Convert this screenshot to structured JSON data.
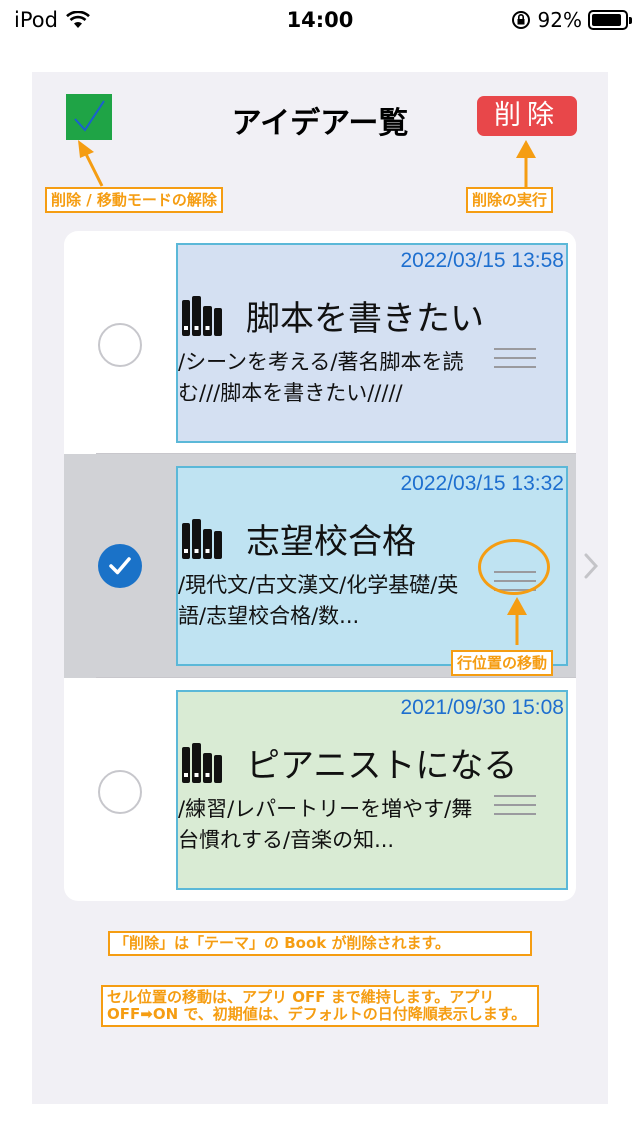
{
  "status_bar": {
    "carrier": "iPod",
    "time": "14:00",
    "battery_percent": "92%",
    "icons": [
      "wifi-icon",
      "rotation-lock-icon",
      "battery-icon"
    ]
  },
  "header": {
    "title": "アイデアー覧",
    "delete_label": "削除",
    "done_icon": "checkmark-icon"
  },
  "annotations": {
    "done_note": "削除 / 移動モードの解除",
    "delete_note": "削除の実行",
    "reorder_note": "行位置の移動",
    "book_note": "「削除」は「テーマ」の Book が削除されます。",
    "cell_note": "セル位置の移動は、アプリ OFF まで維持します。アプリOFF➡ON で、初期値は、デフォルトの日付降順表示します。"
  },
  "items": [
    {
      "date": "2022/03/15 13:58",
      "title": "脚本を書きたい",
      "description": "/シーンを考える/著名脚本を読む///脚本を書きたい/////",
      "selected": false,
      "color": "#d4e0f2"
    },
    {
      "date": "2022/03/15 13:32",
      "title": "志望校合格",
      "description": "/現代文/古文漢文/化学基礎/英語/志望校合格/数...",
      "selected": true,
      "color": "#bfe3f2"
    },
    {
      "date": "2021/09/30 15:08",
      "title": "ピアニストになる",
      "description": "/練習/レパートリーを増やす/舞台慣れする/音楽の知...",
      "selected": false,
      "color": "#d9ebd4"
    }
  ],
  "colors": {
    "accent_annotation": "#f59d12",
    "delete_button": "#e8474a",
    "done_button": "#1fa446",
    "date_text": "#1e6fcf",
    "checked_radio": "#1a72c8"
  }
}
